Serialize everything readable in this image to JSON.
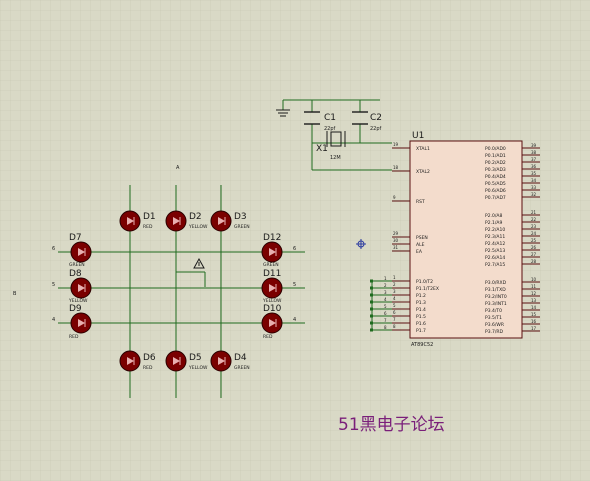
{
  "watermark": "51黑电子论坛",
  "colors": {
    "background": "#d9d9c6",
    "grid": "#c6c6b2",
    "wire": "#1f6b1f",
    "led": "#7a0000",
    "chip_fill": "#f3dccc",
    "chip_border": "#5a1010",
    "watermark": "#7a1f7a"
  },
  "mcu": {
    "ref": "U1",
    "part": "AT89C52",
    "left_pins": [
      {
        "num": "19",
        "name": "XTAL1"
      },
      {
        "num": "18",
        "name": "XTAL2"
      },
      {
        "num": "9",
        "name": "RST"
      },
      {
        "num": "29",
        "name": "PSEN"
      },
      {
        "num": "30",
        "name": "ALE"
      },
      {
        "num": "31",
        "name": "EA"
      },
      {
        "num": "1",
        "name": "P1.0/T2"
      },
      {
        "num": "2",
        "name": "P1.1/T2EX"
      },
      {
        "num": "3",
        "name": "P1.2"
      },
      {
        "num": "4",
        "name": "P1.3"
      },
      {
        "num": "5",
        "name": "P1.4"
      },
      {
        "num": "6",
        "name": "P1.5"
      },
      {
        "num": "7",
        "name": "P1.6"
      },
      {
        "num": "8",
        "name": "P1.7"
      }
    ],
    "right_pins": [
      {
        "num": "39",
        "name": "P0.0/AD0"
      },
      {
        "num": "38",
        "name": "P0.1/AD1"
      },
      {
        "num": "37",
        "name": "P0.2/AD2"
      },
      {
        "num": "36",
        "name": "P0.3/AD3"
      },
      {
        "num": "35",
        "name": "P0.4/AD4"
      },
      {
        "num": "34",
        "name": "P0.5/AD5"
      },
      {
        "num": "33",
        "name": "P0.6/AD6"
      },
      {
        "num": "32",
        "name": "P0.7/AD7"
      },
      {
        "num": "21",
        "name": "P2.0/A8"
      },
      {
        "num": "22",
        "name": "P2.1/A9"
      },
      {
        "num": "23",
        "name": "P2.2/A10"
      },
      {
        "num": "24",
        "name": "P2.3/A11"
      },
      {
        "num": "25",
        "name": "P2.4/A12"
      },
      {
        "num": "26",
        "name": "P2.5/A13"
      },
      {
        "num": "27",
        "name": "P2.6/A14"
      },
      {
        "num": "28",
        "name": "P2.7/A15"
      },
      {
        "num": "10",
        "name": "P3.0/RXD"
      },
      {
        "num": "11",
        "name": "P3.1/TXD"
      },
      {
        "num": "12",
        "name": "P3.2/INT0"
      },
      {
        "num": "13",
        "name": "P3.3/INT1"
      },
      {
        "num": "14",
        "name": "P3.4/T0"
      },
      {
        "num": "15",
        "name": "P3.5/T1"
      },
      {
        "num": "16",
        "name": "P3.6/WR"
      },
      {
        "num": "17",
        "name": "P3.7/RD"
      }
    ],
    "p1_net_labels": [
      "1",
      "2",
      "3",
      "4",
      "5",
      "6",
      "7",
      "8"
    ]
  },
  "crystal": {
    "ref": "X1",
    "value": "12M"
  },
  "capacitors": [
    {
      "ref": "C1",
      "value": "22pf"
    },
    {
      "ref": "C2",
      "value": "22pf"
    }
  ],
  "leds": [
    {
      "ref": "D1",
      "color": "RED"
    },
    {
      "ref": "D2",
      "color": "YELLOW"
    },
    {
      "ref": "D3",
      "color": "GREEN"
    },
    {
      "ref": "D7",
      "color": "GREEN"
    },
    {
      "ref": "D8",
      "color": "YELLOW"
    },
    {
      "ref": "D9",
      "color": "RED"
    },
    {
      "ref": "D12",
      "color": "GREEN"
    },
    {
      "ref": "D11",
      "color": "YELLOW"
    },
    {
      "ref": "D10",
      "color": "RED"
    },
    {
      "ref": "D6",
      "color": "RED"
    },
    {
      "ref": "D5",
      "color": "YELLOW"
    },
    {
      "ref": "D4",
      "color": "GREEN"
    }
  ],
  "net_labels": {
    "top": "A",
    "west": [
      "6",
      "5",
      "4"
    ],
    "east": [
      "6",
      "5",
      "4"
    ],
    "margin_mark": "B"
  }
}
